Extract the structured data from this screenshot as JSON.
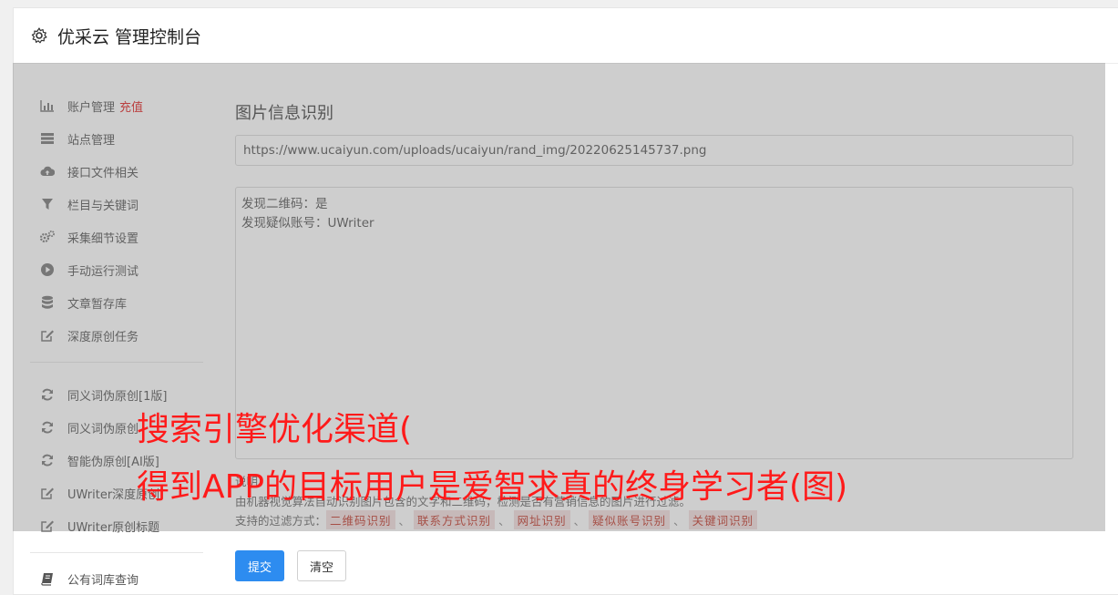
{
  "header": {
    "title": "优采云 管理控制台"
  },
  "sidebar": {
    "items": [
      {
        "label": "账户管理",
        "badge": "充值"
      },
      {
        "label": "站点管理"
      },
      {
        "label": "接口文件相关"
      },
      {
        "label": "栏目与关键词"
      },
      {
        "label": "采集细节设置"
      },
      {
        "label": "手动运行测试"
      },
      {
        "label": "文章暂存库"
      },
      {
        "label": "深度原创任务"
      },
      {
        "label": "同义词伪原创[1版]"
      },
      {
        "label": "同义词伪原创"
      },
      {
        "label": "智能伪原创[AI版]"
      },
      {
        "label": "UWriter深度原创"
      },
      {
        "label": "UWriter原创标题"
      },
      {
        "label": "公有词库查询"
      }
    ]
  },
  "main": {
    "section_title": "图片信息识别",
    "url_value": "https://www.ucaiyun.com/uploads/ucaiyun/rand_img/20220625145737.png",
    "result_lines": [
      "发现二维码：是",
      "发现疑似账号：UWriter"
    ],
    "note_title": "说明：",
    "note_text": "由机器视觉算法自动识别图片包含的文字和二维码，检测是否有营销信息的图片进行过滤。",
    "filter_label": "支持的过滤方式：",
    "filters": [
      "二维码识别",
      "联系方式识别",
      "网址识别",
      "疑似账号识别",
      "关键词识别"
    ],
    "submit_label": "提交",
    "clear_label": "清空"
  },
  "watermark": {
    "line1": "搜索引擎优化渠道(",
    "line2": "得到APP的目标用户是爱智求真的终身学习者(图)"
  },
  "colors": {
    "accent": "#2d8cf0",
    "badge": "#e02020",
    "watermark": "#ff1a1a",
    "tag_bg": "#f2dede",
    "tag_text": "#c0392b"
  }
}
